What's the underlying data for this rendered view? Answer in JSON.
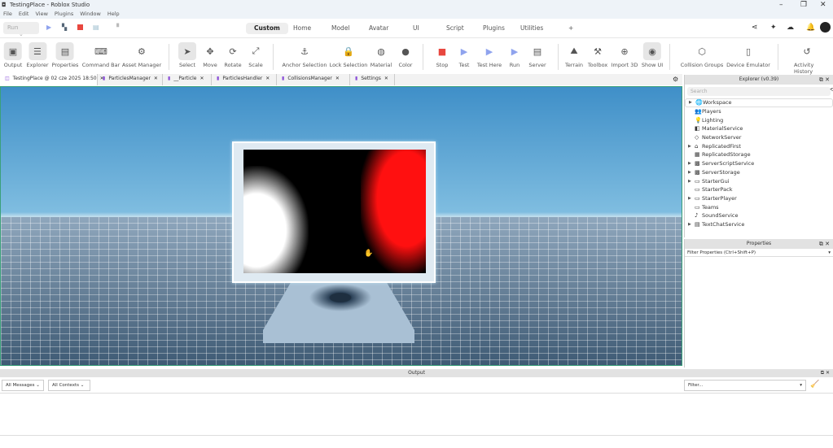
{
  "window": {
    "title": "TestingPlace - Roblox Studio",
    "min": "–",
    "max": "❐",
    "close": "✕"
  },
  "menu": [
    "File",
    "Edit",
    "View",
    "Plugins",
    "Window",
    "Help"
  ],
  "topbar": {
    "run_select": "Run",
    "tabs": [
      "Custom",
      "Home",
      "Model",
      "Avatar",
      "UI",
      "Script",
      "Plugins",
      "Utilities",
      "+"
    ],
    "active_tab": "Custom"
  },
  "ribbon": {
    "tools": [
      {
        "label": "Output",
        "icon": "▣"
      },
      {
        "label": "Explorer",
        "icon": "☰"
      },
      {
        "label": "Properties",
        "icon": "▤"
      },
      {
        "label": "Command Bar",
        "icon": "⌨"
      },
      {
        "label": "Asset Manager",
        "icon": "⚙"
      },
      {
        "label": "Select",
        "icon": "➤"
      },
      {
        "label": "Move",
        "icon": "✥"
      },
      {
        "label": "Rotate",
        "icon": "⟳"
      },
      {
        "label": "Scale",
        "icon": "⤢"
      },
      {
        "label": "Anchor Selection",
        "icon": "⚓"
      },
      {
        "label": "Lock Selection",
        "icon": "🔒"
      },
      {
        "label": "Material",
        "icon": "◍"
      },
      {
        "label": "Color",
        "icon": "●"
      },
      {
        "label": "Stop",
        "icon": "■"
      },
      {
        "label": "Test",
        "icon": "▶"
      },
      {
        "label": "Test Here",
        "icon": "▶"
      },
      {
        "label": "Run",
        "icon": "▶"
      },
      {
        "label": "Server",
        "icon": "▤"
      },
      {
        "label": "Terrain",
        "icon": "⛰"
      },
      {
        "label": "Toolbox",
        "icon": "⚒"
      },
      {
        "label": "Import 3D",
        "icon": "⊕"
      },
      {
        "label": "Show UI",
        "icon": "◉"
      },
      {
        "label": "Collision Groups",
        "icon": "⬡"
      },
      {
        "label": "Device Emulator",
        "icon": "▯"
      },
      {
        "label": "Activity History",
        "icon": "↺"
      }
    ]
  },
  "doc_tabs": [
    "TestingPlace @ 02 cze 2025 18:50",
    "ParticlesManager",
    "__Particle",
    "ParticlesHandler",
    "CollisionsManager",
    "Settings"
  ],
  "explorer": {
    "title": "Explorer (v0.39)",
    "search_placeholder": "Search",
    "items": [
      {
        "name": "Workspace",
        "icon": "🌐",
        "expandable": true
      },
      {
        "name": "Players",
        "icon": "👥",
        "expandable": false
      },
      {
        "name": "Lighting",
        "icon": "💡",
        "expandable": false
      },
      {
        "name": "MaterialService",
        "icon": "◧",
        "expandable": false
      },
      {
        "name": "NetworkServer",
        "icon": "◇",
        "expandable": false
      },
      {
        "name": "ReplicatedFirst",
        "icon": "⌂",
        "expandable": true
      },
      {
        "name": "ReplicatedStorage",
        "icon": "▦",
        "expandable": false
      },
      {
        "name": "ServerScriptService",
        "icon": "▩",
        "expandable": true
      },
      {
        "name": "ServerStorage",
        "icon": "▩",
        "expandable": true
      },
      {
        "name": "StarterGui",
        "icon": "▭",
        "expandable": true
      },
      {
        "name": "StarterPack",
        "icon": "▭",
        "expandable": false
      },
      {
        "name": "StarterPlayer",
        "icon": "▭",
        "expandable": true
      },
      {
        "name": "Teams",
        "icon": "▭",
        "expandable": false
      },
      {
        "name": "SoundService",
        "icon": "♪",
        "expandable": false
      },
      {
        "name": "TextChatService",
        "icon": "▤",
        "expandable": true
      }
    ]
  },
  "properties": {
    "title": "Properties",
    "filter_placeholder": "Filter Properties (Ctrl+Shift+P)"
  },
  "output": {
    "title": "Output",
    "messages_select": "All Messages",
    "contexts_select": "All Contexts",
    "filter_placeholder": "Filter..."
  },
  "colors": {
    "stop": "#e8473f",
    "play": "#8fa3ee",
    "viewport_border": "#3aa07a"
  }
}
